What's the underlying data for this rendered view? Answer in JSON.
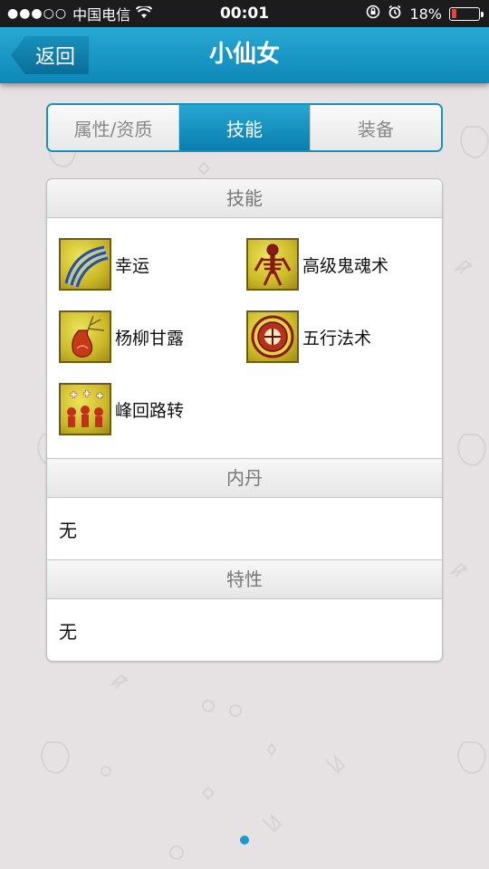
{
  "status_bar": {
    "signal_dots": "●●●○○",
    "carrier": "中国电信",
    "time": "00:01",
    "battery_percent": "18%",
    "battery_color": "#ff3b30"
  },
  "nav": {
    "back_label": "返回",
    "title": "小仙女"
  },
  "tabs": [
    {
      "label": "属性/资质",
      "active": false
    },
    {
      "label": "技能",
      "active": true
    },
    {
      "label": "装备",
      "active": false
    }
  ],
  "sections": {
    "skills": {
      "header": "技能",
      "items": [
        {
          "label": "幸运",
          "icon": "wave-skill-icon"
        },
        {
          "label": "高级鬼魂术",
          "icon": "skeleton-skill-icon"
        },
        {
          "label": "杨柳甘露",
          "icon": "vase-skill-icon"
        },
        {
          "label": "五行法术",
          "icon": "seal-skill-icon"
        },
        {
          "label": "峰回路转",
          "icon": "figures-skill-icon"
        }
      ]
    },
    "neidan": {
      "header": "内丹",
      "value": "无"
    },
    "traits": {
      "header": "特性",
      "value": "无"
    }
  },
  "colors": {
    "accent": "#1a8fb8",
    "page_background": "#e6e1e2",
    "page_indicator": "#1a9ad0"
  }
}
